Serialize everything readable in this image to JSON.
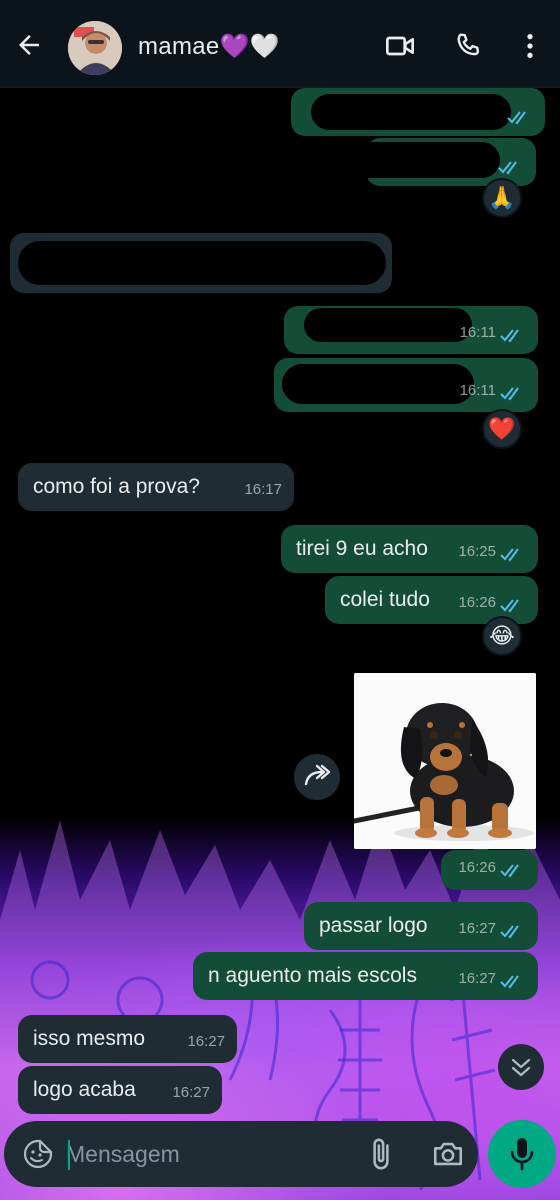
{
  "header": {
    "contact_name": "mamae💜🤍",
    "icons": [
      "back-arrow-icon",
      "video-call-icon",
      "phone-icon",
      "more-vert-icon"
    ]
  },
  "colors": {
    "header_bg": "#0b141a",
    "incoming_bubble": "#1f2c34",
    "outgoing_bubble": "#144d37",
    "read_ticks": "#53bdeb",
    "accent": "#00a884"
  },
  "messages": [
    {
      "id": "m1",
      "direction": "out",
      "text": "",
      "time": "",
      "redacted": true
    },
    {
      "id": "m2",
      "direction": "out",
      "text": "",
      "time": "",
      "redacted": true,
      "reaction": "🙏"
    },
    {
      "id": "m3",
      "direction": "in",
      "text": "",
      "time": "",
      "redacted": true
    },
    {
      "id": "m4",
      "direction": "out",
      "text": "",
      "time": "16:11",
      "redacted": true
    },
    {
      "id": "m5",
      "direction": "out",
      "text": "",
      "time": "16:11",
      "redacted": true,
      "reaction": "❤️"
    },
    {
      "id": "m6",
      "direction": "in",
      "text": "como foi a prova?",
      "time": "16:17"
    },
    {
      "id": "m7",
      "direction": "out",
      "text": "tirei 9 eu acho",
      "time": "16:25"
    },
    {
      "id": "m8",
      "direction": "out",
      "text": "colei tudo",
      "time": "16:26",
      "reaction": "😂"
    },
    {
      "id": "m9",
      "direction": "out",
      "type": "image",
      "image_subject": "dachshund puppy",
      "time": "16:26"
    },
    {
      "id": "m10",
      "direction": "out",
      "text": "passar logo",
      "time": "16:27"
    },
    {
      "id": "m11",
      "direction": "out",
      "text": "n aguento mais escols",
      "time": "16:27"
    },
    {
      "id": "m12",
      "direction": "in",
      "text": "isso mesmo",
      "time": "16:27"
    },
    {
      "id": "m13",
      "direction": "in",
      "text": "logo acaba",
      "time": "16:27"
    }
  ],
  "composer": {
    "placeholder": "Mensagem",
    "icons": [
      "sticker-icon",
      "attach-icon",
      "camera-icon",
      "mic-icon"
    ]
  }
}
